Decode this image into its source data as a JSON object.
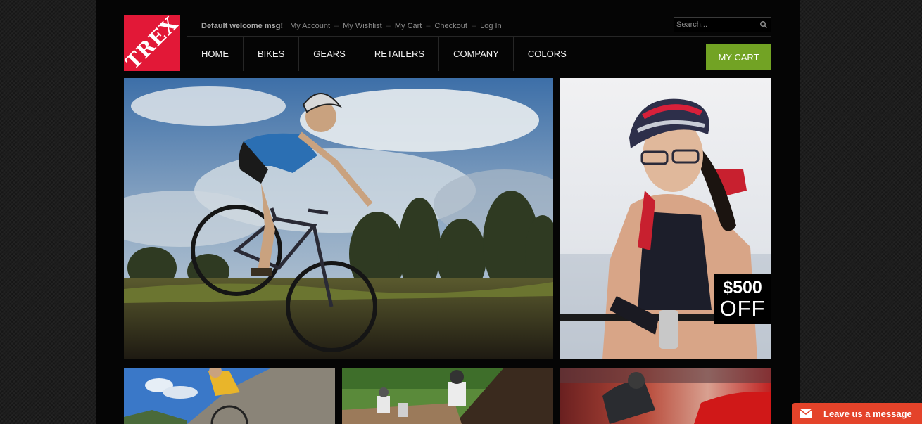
{
  "brand": {
    "logo_text": "TREX",
    "logo_color": "#e21837"
  },
  "header": {
    "welcome": "Default welcome msg!",
    "links": [
      "My Account",
      "My Wishlist",
      "My Cart",
      "Checkout",
      "Log In"
    ],
    "search_placeholder": "Search...",
    "search_icon": "search-icon"
  },
  "nav": {
    "items": [
      "HOME",
      "BIKES",
      "GEARS",
      "RETAILERS",
      "COMPANY",
      "COLORS"
    ],
    "active": "HOME",
    "cart_label": "MY CART",
    "cart_color": "#72a324"
  },
  "promo": {
    "amount": "$500",
    "label": "OFF"
  },
  "chat": {
    "label": "Leave us a message",
    "icon": "envelope-icon",
    "color": "#e4432a"
  }
}
